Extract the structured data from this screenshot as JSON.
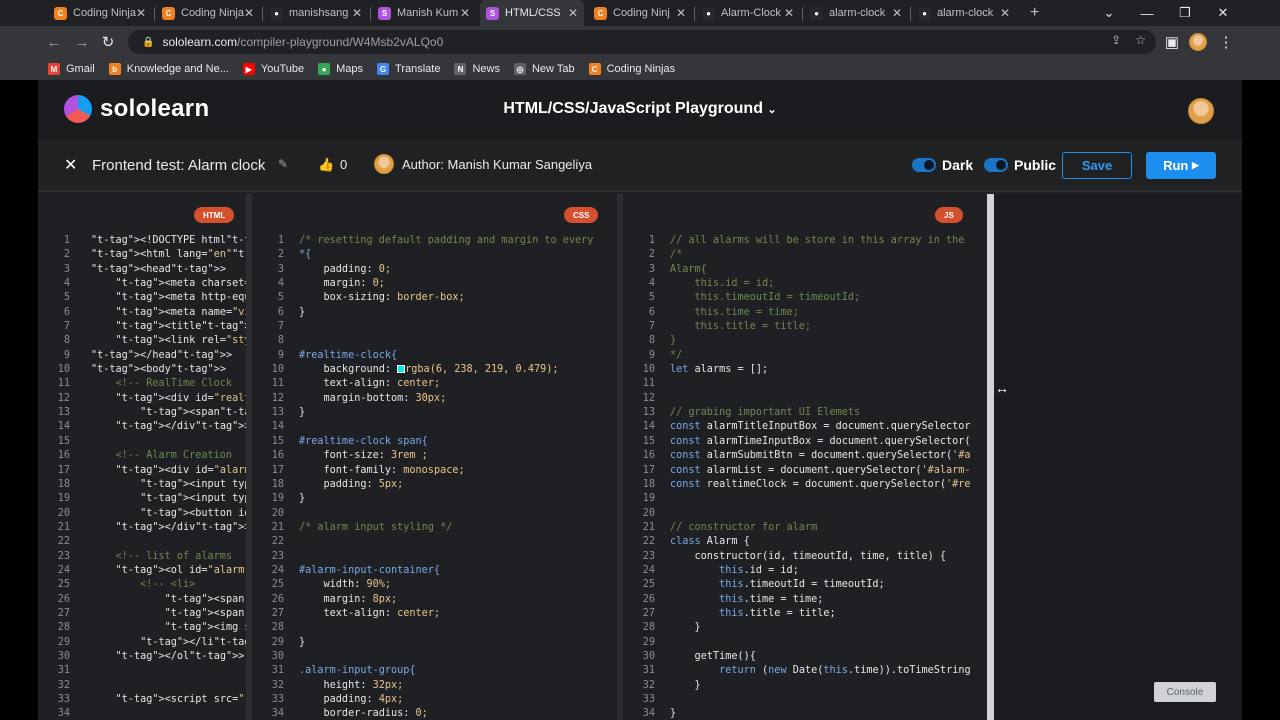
{
  "browser": {
    "tabs": [
      {
        "title": "Coding Ninja",
        "icon": "coding-ninjas-icon",
        "active": false
      },
      {
        "title": "Coding Ninja",
        "icon": "coding-ninjas-icon",
        "active": false
      },
      {
        "title": "manishsang",
        "icon": "github-icon",
        "active": false
      },
      {
        "title": "Manish Kum",
        "icon": "sololearn-icon",
        "active": false
      },
      {
        "title": "HTML/CSS",
        "icon": "sololearn-icon",
        "active": true
      },
      {
        "title": "Coding Ninj",
        "icon": "coding-ninjas-icon",
        "active": false
      },
      {
        "title": "Alarm-Clock",
        "icon": "github-icon",
        "active": false
      },
      {
        "title": "alarm-clock",
        "icon": "github-icon",
        "active": false
      },
      {
        "title": "alarm-clock",
        "icon": "github-icon",
        "active": false
      }
    ],
    "new_tab": "+",
    "url_host": "sololearn.com",
    "url_path": "/compiler-playground/W4Msb2vALQo0",
    "bookmarks": [
      {
        "label": "Gmail",
        "color": "#ea4335",
        "glyph": "M"
      },
      {
        "label": "Knowledge and Ne...",
        "color": "#f4801f",
        "glyph": "b"
      },
      {
        "label": "YouTube",
        "color": "#ff0000",
        "glyph": "▶"
      },
      {
        "label": "Maps",
        "color": "#34a853",
        "glyph": "●"
      },
      {
        "label": "Translate",
        "color": "#4285f4",
        "glyph": "G"
      },
      {
        "label": "News",
        "color": "#5f6368",
        "glyph": "N"
      },
      {
        "label": "New Tab",
        "color": "#5f6368",
        "glyph": "◎"
      },
      {
        "label": "Coding Ninjas",
        "color": "#f4801f",
        "glyph": "C"
      }
    ]
  },
  "site": {
    "logo": "sololearn",
    "page_title": "HTML/CSS/JavaScript Playground",
    "project_title": "Frontend test: Alarm clock",
    "likes": "0",
    "author": "Author: Manish Kumar Sangeliya",
    "dark_label": "Dark",
    "public_label": "Public",
    "save_label": "Save",
    "run_label": "Run",
    "console_label": "Console"
  },
  "editors": {
    "html": {
      "badge": "HTML",
      "lines": [
        "<!DOCTYPE html>",
        "<html lang=\"en\">",
        "<head>",
        "    <meta charset=\"UTF-8",
        "    <meta http-equiv=\"X-",
        "    <meta name=\"viewport",
        "    <title>Alarm Clock</",
        "    <link rel=\"styleshee",
        "</head>",
        "<body>",
        "    <!-- RealTime Clock",
        "    <div id=\"realtime-cl",
        "        <span>12:01:22 A",
        "    </div>",
        "",
        "    <!-- Alarm Creation",
        "    <div id=\"alarm-input",
        "        <input type=\"tex",
        "        <input type=\"tex",
        "        <button id=\"alar",
        "    </div>",
        "",
        "    <!-- list of alarms",
        "    <ol id=\"alarm-list\">",
        "        <!-- <li>",
        "            <span class=",
        "            <span class=",
        "            <img src=\"re",
        "        </li>  -->",
        "    </ol>",
        "",
        "",
        "    <script src=\"./scrip",
        "    "
      ]
    },
    "css": {
      "badge": "CSS",
      "lines": [
        "/* resetting default padding and margin to every",
        "*{",
        "    padding: 0;",
        "    margin: 0;",
        "    box-sizing: border-box;",
        "}",
        "",
        "",
        "#realtime-clock{",
        "    background:   rgba(6, 238, 219, 0.479);",
        "    text-align: center;",
        "    margin-bottom: 30px;",
        "}",
        "",
        "#realtime-clock span{",
        "    font-size: 3rem ;",
        "    font-family: monospace;",
        "    padding: 5px;",
        "}",
        "",
        "/* alarm input styling */",
        "",
        "",
        "#alarm-input-container{",
        "    width: 90%;",
        "    margin: 8px;",
        "    text-align: center;",
        "",
        "}",
        "",
        ".alarm-input-group{",
        "    height: 32px;",
        "    padding: 4px;",
        "    border-radius: 0;"
      ]
    },
    "js": {
      "badge": "JS",
      "lines": [
        "// all alarms will be store in this array in the",
        "/*",
        "Alarm{",
        "    this.id = id;",
        "    this.timeoutId = timeoutId;",
        "    this.time = time;",
        "    this.title = title;",
        "}",
        "*/",
        "let alarms = [];",
        "",
        "",
        "// grabing important UI Elemets",
        "const alarmTitleInputBox = document.querySelector",
        "const alarmTimeInputBox = document.querySelector(",
        "const alarmSubmitBtn = document.querySelector('#a",
        "const alarmList = document.querySelector('#alarm-",
        "const realtimeClock = document.querySelector('#re",
        "",
        "",
        "// constructor for alarm",
        "class Alarm {",
        "    constructor(id, timeoutId, time, title) {",
        "        this.id = id;",
        "        this.timeoutId = timeoutId;",
        "        this.time = time;",
        "        this.title = title;",
        "    }",
        "",
        "    getTime(){",
        "        return (new Date(this.time)).toTimeString",
        "    }",
        "",
        "}"
      ]
    }
  },
  "colors": {
    "accent": "#1c8ef0",
    "badge": "#d4502f",
    "swatch": "#06eedb"
  }
}
